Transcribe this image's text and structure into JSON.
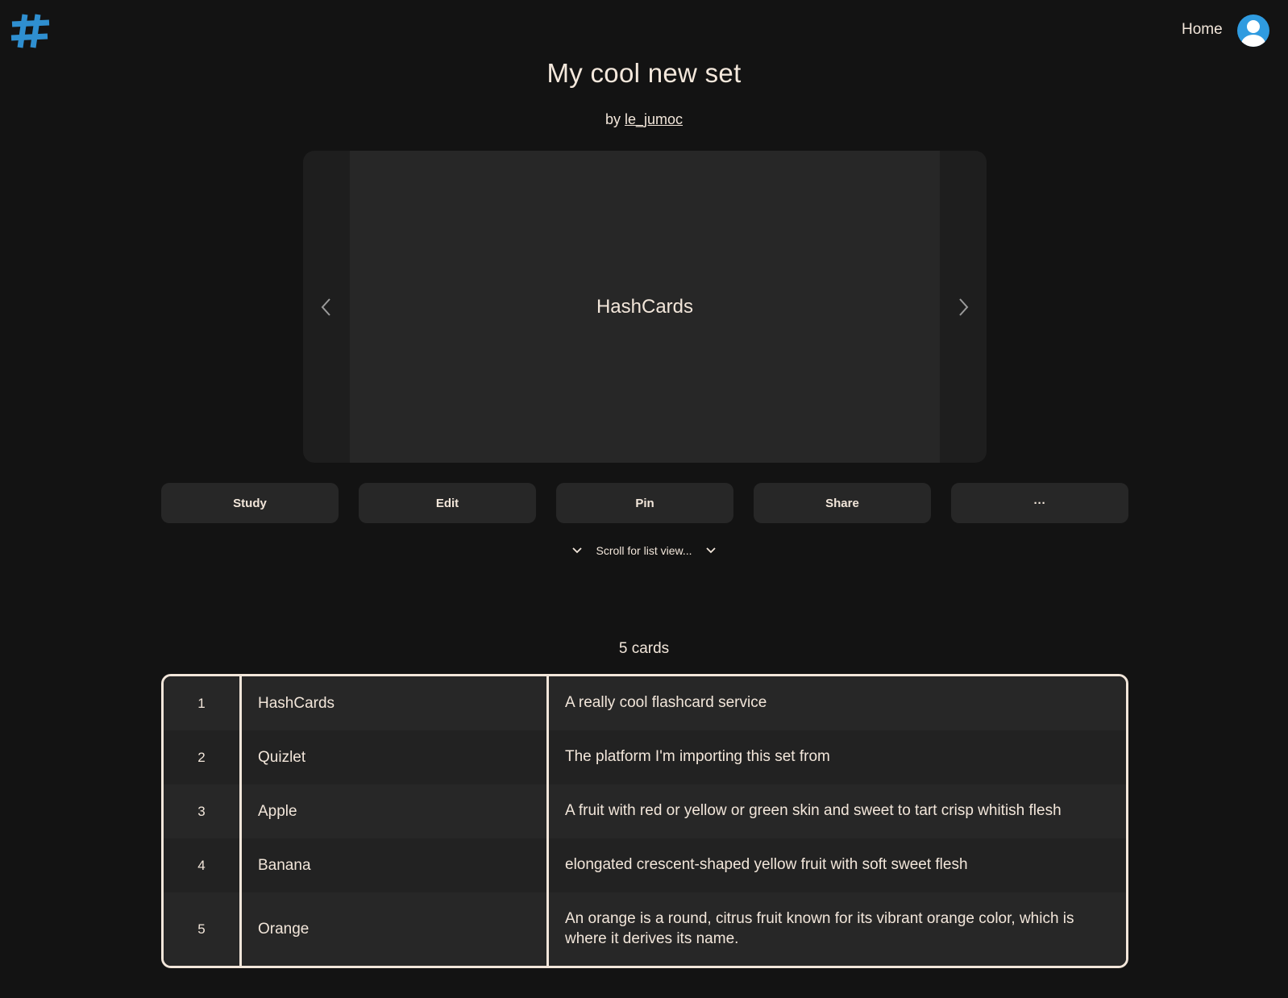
{
  "header": {
    "logo_icon": "hash-icon",
    "home_label": "Home",
    "avatar_icon": "user-avatar-icon",
    "brand_color": "#2f8fd0"
  },
  "set": {
    "title": "My cool new set",
    "by_prefix": "by",
    "author": "le_jumoc"
  },
  "viewer": {
    "current_card_text": "HashCards",
    "prev_icon": "chevron-left-icon",
    "next_icon": "chevron-right-icon"
  },
  "actions": [
    "Study",
    "Edit",
    "Pin",
    "Share",
    "···"
  ],
  "scroll_hint": "Scroll for list view...",
  "card_count": "5 cards",
  "cards": [
    {
      "num": "1",
      "term": "HashCards",
      "definition": "A really cool flashcard service"
    },
    {
      "num": "2",
      "term": "Quizlet",
      "definition": "The platform I'm importing this set from"
    },
    {
      "num": "3",
      "term": "Apple",
      "definition": "A fruit with red or yellow or green skin and sweet to tart crisp whitish flesh"
    },
    {
      "num": "4",
      "term": "Banana",
      "definition": "elongated crescent-shaped yellow fruit with soft sweet flesh"
    },
    {
      "num": "5",
      "term": "Orange",
      "definition": "An orange is a round, citrus fruit known for its vibrant orange color, which is where it derives its name."
    }
  ],
  "colors": {
    "background": "#131313",
    "surface": "#272727",
    "text": "#f2e6da",
    "accent": "#2f9be0"
  }
}
